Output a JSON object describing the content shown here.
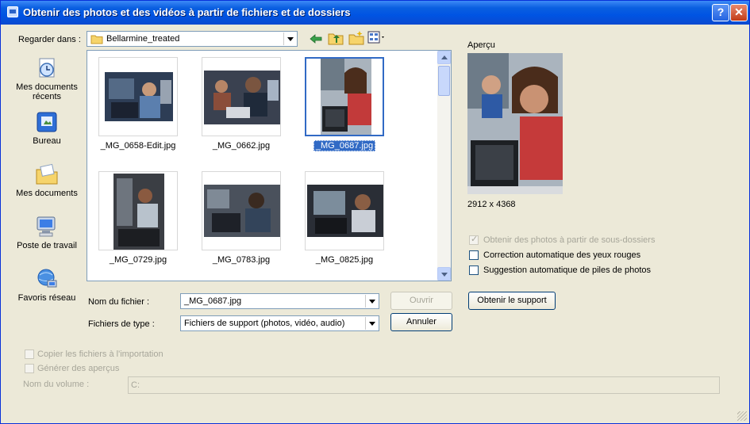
{
  "window": {
    "title": "Obtenir des photos et des vidéos à partir de fichiers et de dossiers",
    "help_btn": "?",
    "close_btn": "✕"
  },
  "toolbar": {
    "look_in_label": "Regarder dans :",
    "look_in_value": "Bellarmine_treated",
    "icons": [
      "back-arrow-icon",
      "up-folder-icon",
      "new-folder-icon",
      "view-menu-icon"
    ]
  },
  "places": [
    {
      "id": "recent",
      "label": "Mes documents récents",
      "icon": "recent-documents-icon"
    },
    {
      "id": "desktop",
      "label": "Bureau",
      "icon": "desktop-icon"
    },
    {
      "id": "mydocs",
      "label": "Mes documents",
      "icon": "my-documents-icon"
    },
    {
      "id": "mycomputer",
      "label": "Poste de travail",
      "icon": "my-computer-icon"
    },
    {
      "id": "network",
      "label": "Favoris réseau",
      "icon": "network-places-icon"
    }
  ],
  "files": [
    {
      "name": "_MG_0658-Edit.jpg",
      "selected": false
    },
    {
      "name": "_MG_0662.jpg",
      "selected": false
    },
    {
      "name": "_MG_0687.jpg",
      "selected": true
    },
    {
      "name": "_MG_0729.jpg",
      "selected": false
    },
    {
      "name": "_MG_0783.jpg",
      "selected": false
    },
    {
      "name": "_MG_0825.jpg",
      "selected": false
    }
  ],
  "form": {
    "filename_label": "Nom du fichier :",
    "filename_value": "_MG_0687.jpg",
    "filetype_label": "Fichiers de type :",
    "filetype_value": "Fichiers de support (photos, vidéo, audio)",
    "open_button": "Ouvrir",
    "cancel_button": "Annuler"
  },
  "preview": {
    "label": "Aperçu",
    "dimensions": "2912 x 4368"
  },
  "options": {
    "subfolders": {
      "label": "Obtenir des photos à partir de sous-dossiers",
      "checked": true,
      "enabled": false
    },
    "redeye": {
      "label": "Correction automatique des yeux rouges",
      "checked": false,
      "enabled": true
    },
    "stacks": {
      "label": "Suggestion automatique de piles de photos",
      "checked": false,
      "enabled": true
    },
    "get_media_button": "Obtenir le support"
  },
  "bottom": {
    "copy_files": {
      "label": "Copier les fichiers à l'importation",
      "checked": false
    },
    "gen_previews": {
      "label": "Générer des aperçus",
      "checked": false
    },
    "volume_label": "Nom du volume :",
    "volume_value": "C:"
  },
  "colors": {
    "title_bar": "#0054e3",
    "selection": "#316ac5",
    "dialog_bg": "#ece9d8"
  }
}
